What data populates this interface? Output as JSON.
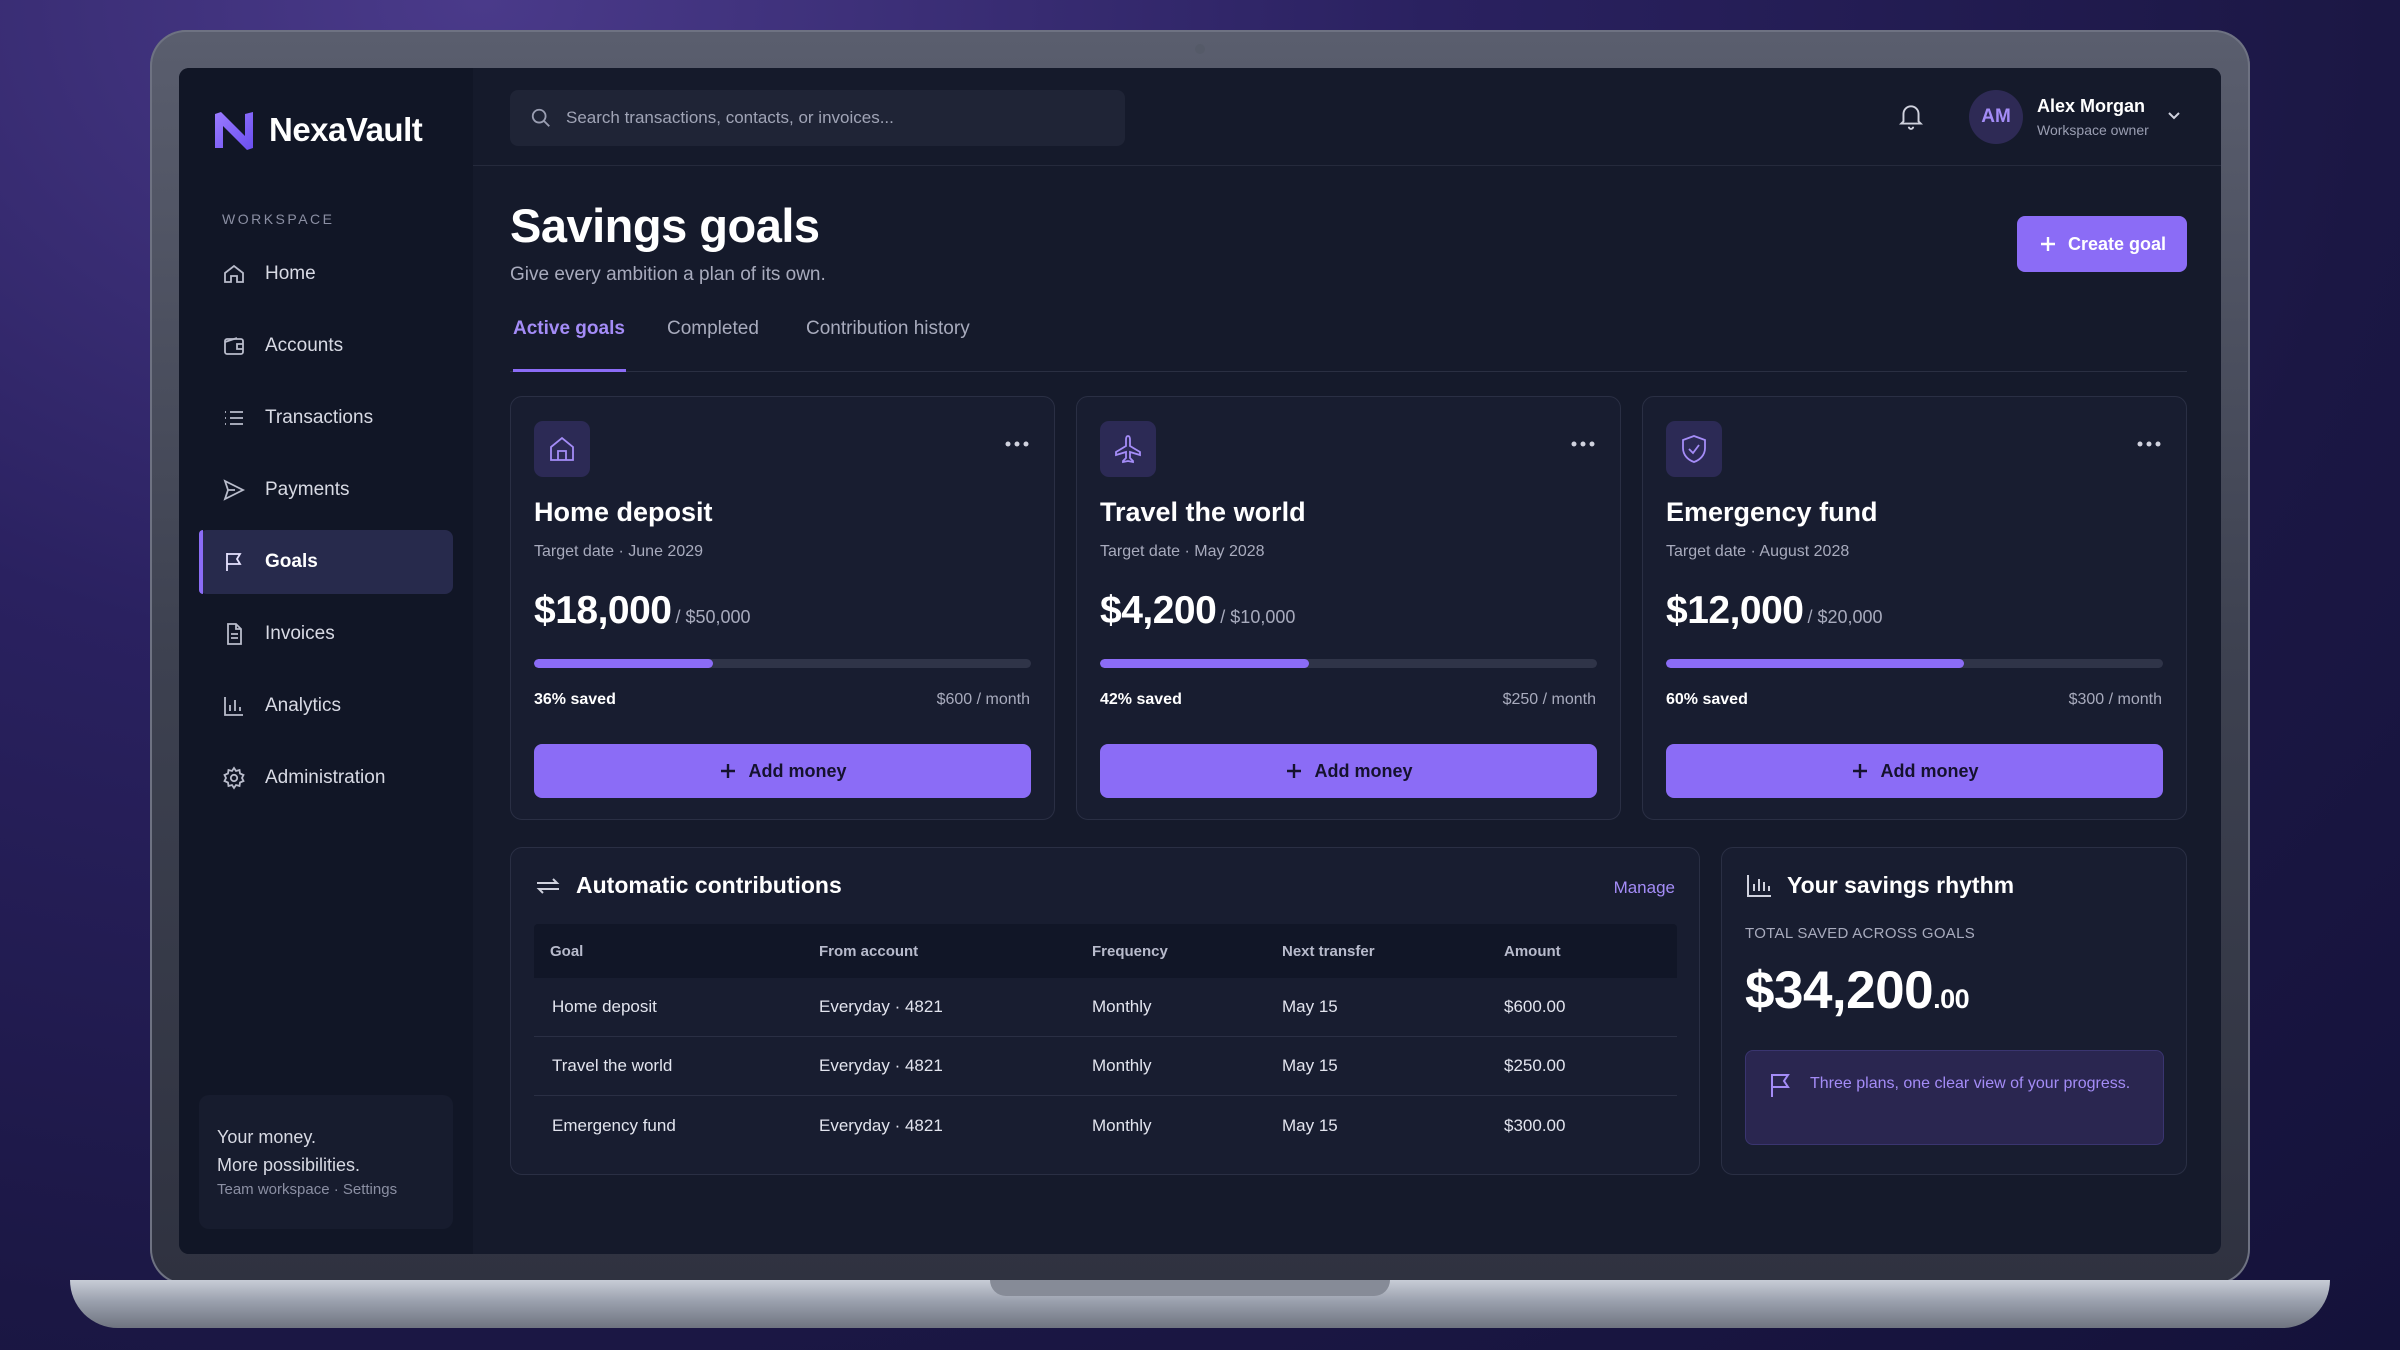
{
  "app": {
    "name": "NexaVault"
  },
  "sidebar": {
    "section_label": "WORKSPACE",
    "items": [
      {
        "label": "Home",
        "icon": "home-icon"
      },
      {
        "label": "Accounts",
        "icon": "wallet-icon"
      },
      {
        "label": "Transactions",
        "icon": "list-icon"
      },
      {
        "label": "Payments",
        "icon": "send-icon"
      },
      {
        "label": "Goals",
        "icon": "flag-icon",
        "active": true
      },
      {
        "label": "Invoices",
        "icon": "document-icon"
      },
      {
        "label": "Analytics",
        "icon": "bar-chart-icon"
      },
      {
        "label": "Administration",
        "icon": "gear-icon"
      }
    ],
    "footer": {
      "line1": "Your money.",
      "line2": "More possibilities.",
      "line3": "Team workspace · Settings"
    }
  },
  "topbar": {
    "search_placeholder": "Search transactions, contacts, or invoices...",
    "user": {
      "initials": "AM",
      "name": "Alex Morgan",
      "role": "Workspace owner"
    }
  },
  "page": {
    "title": "Savings goals",
    "subtitle": "Give every ambition a plan of its own.",
    "create_label": "Create goal",
    "tabs": [
      "Active goals",
      "Completed",
      "Contribution history"
    ],
    "active_tab": 0
  },
  "goals": [
    {
      "title": "Home deposit",
      "date": "Target date · June 2029",
      "amount": "$18,000",
      "target": "/ $50,000",
      "progress": 0.36,
      "pct_label": "36% saved",
      "rate": "$600 / month",
      "icon": "house-icon",
      "add_label": "Add money"
    },
    {
      "title": "Travel the world",
      "date": "Target date · May 2028",
      "amount": "$4,200",
      "target": "/ $10,000",
      "progress": 0.42,
      "pct_label": "42% saved",
      "rate": "$250 / month",
      "icon": "plane-icon",
      "add_label": "Add money"
    },
    {
      "title": "Emergency fund",
      "date": "Target date · August 2028",
      "amount": "$12,000",
      "target": "/ $20,000",
      "progress": 0.6,
      "pct_label": "60% saved",
      "rate": "$300 / month",
      "icon": "shield-icon",
      "add_label": "Add money"
    }
  ],
  "auto": {
    "title": "Automatic contributions",
    "manage_label": "Manage",
    "columns": [
      "Goal",
      "From account",
      "Frequency",
      "Next transfer",
      "Amount"
    ],
    "rows": [
      [
        "Home deposit",
        "Everyday · 4821",
        "Monthly",
        "May 15",
        "$600.00"
      ],
      [
        "Travel the world",
        "Everyday · 4821",
        "Monthly",
        "May 15",
        "$250.00"
      ],
      [
        "Emergency fund",
        "Everyday · 4821",
        "Monthly",
        "May 15",
        "$300.00"
      ]
    ]
  },
  "rhythm": {
    "title": "Your savings rhythm",
    "label": "TOTAL SAVED ACROSS GOALS",
    "total": "$34,200",
    "cents": ".00",
    "note": "Three plans, one clear view of your progress."
  },
  "colors": {
    "accent": "#8b6cf6",
    "accent_text": "#a48cf7",
    "background": "#151a2b",
    "card": "#181d30"
  }
}
